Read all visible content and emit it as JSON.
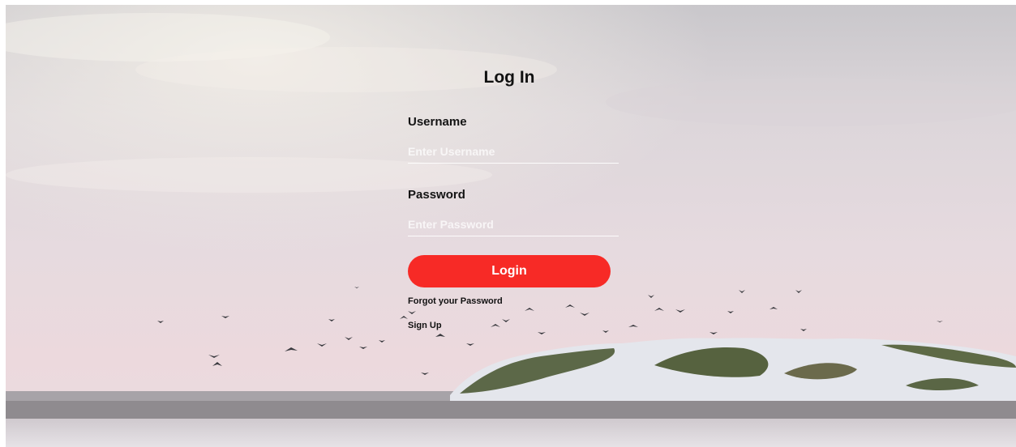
{
  "form": {
    "title": "Log In",
    "username": {
      "label": "Username",
      "placeholder": "Enter Username",
      "value": ""
    },
    "password": {
      "label": "Password",
      "placeholder": "Enter Password",
      "value": ""
    },
    "login_label": "Login",
    "forgot_label": "Forgot your Password",
    "signup_label": "Sign Up"
  },
  "colors": {
    "accent": "#f72a26",
    "text": "#111111",
    "input_line": "#ffffff"
  }
}
